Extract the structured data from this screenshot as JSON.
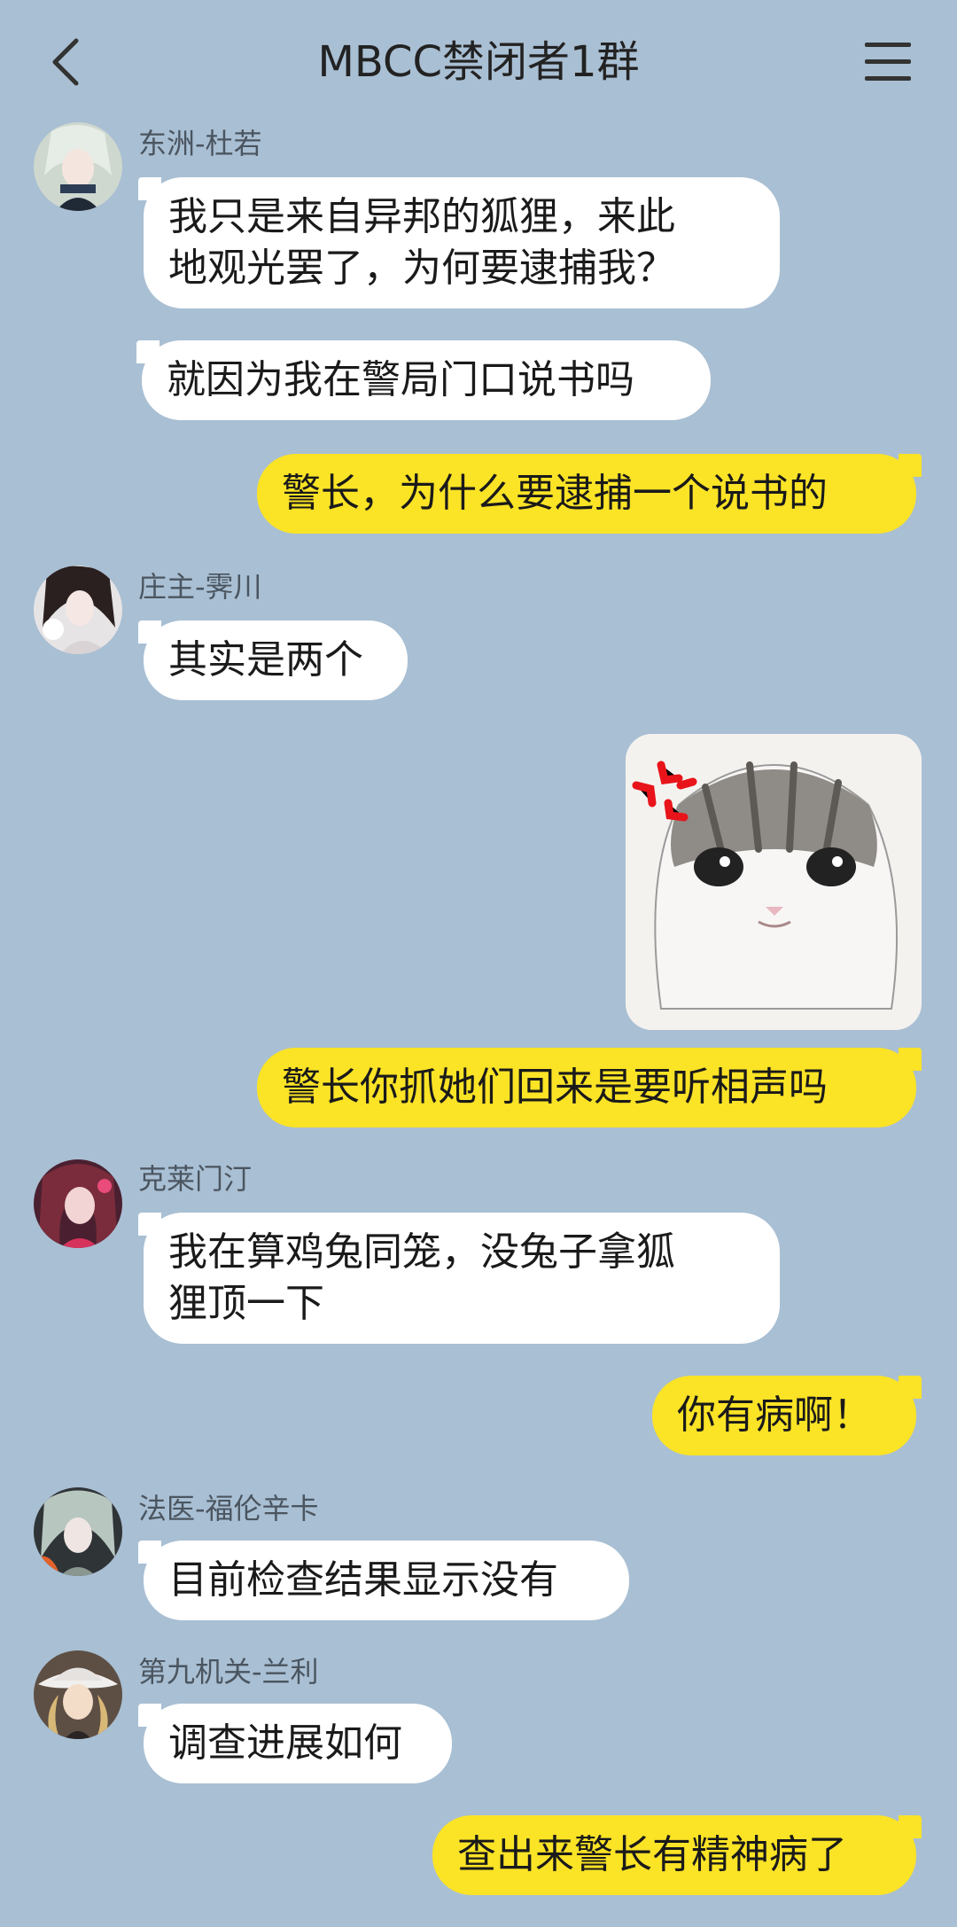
{
  "header": {
    "title": "MBCC禁闭者1群"
  },
  "messages": [
    {
      "side": "left",
      "sender": "东洲-杜若",
      "lines": [
        "我只是来自异邦的狐狸，来此",
        "地观光罢了，为何要逮捕我？"
      ]
    },
    {
      "side": "left",
      "lines": [
        "就因为我在警局门口说书吗"
      ]
    },
    {
      "side": "right",
      "lines": [
        "警长，为什么要逮捕一个说书的"
      ]
    },
    {
      "side": "left",
      "sender": "庄主-霁川",
      "lines": [
        "其实是两个"
      ]
    },
    {
      "side": "right",
      "sticker": "angry-cat-sticker"
    },
    {
      "side": "right",
      "lines": [
        "警长你抓她们回来是要听相声吗"
      ]
    },
    {
      "side": "left",
      "sender": "克莱门汀",
      "lines": [
        "我在算鸡兔同笼，没兔子拿狐",
        "狸顶一下"
      ]
    },
    {
      "side": "right",
      "lines": [
        "你有病啊！"
      ]
    },
    {
      "side": "left",
      "sender": "法医-福伦辛卡",
      "lines": [
        "目前检查结果显示没有"
      ]
    },
    {
      "side": "left",
      "sender": "第九机关-兰利",
      "lines": [
        "调查进展如何"
      ]
    },
    {
      "side": "right",
      "lines": [
        "查出来警长有精神病了"
      ]
    }
  ],
  "colors": {
    "background": "#a9bfd3",
    "own_bubble": "#fbe326",
    "other_bubble": "#ffffff"
  }
}
